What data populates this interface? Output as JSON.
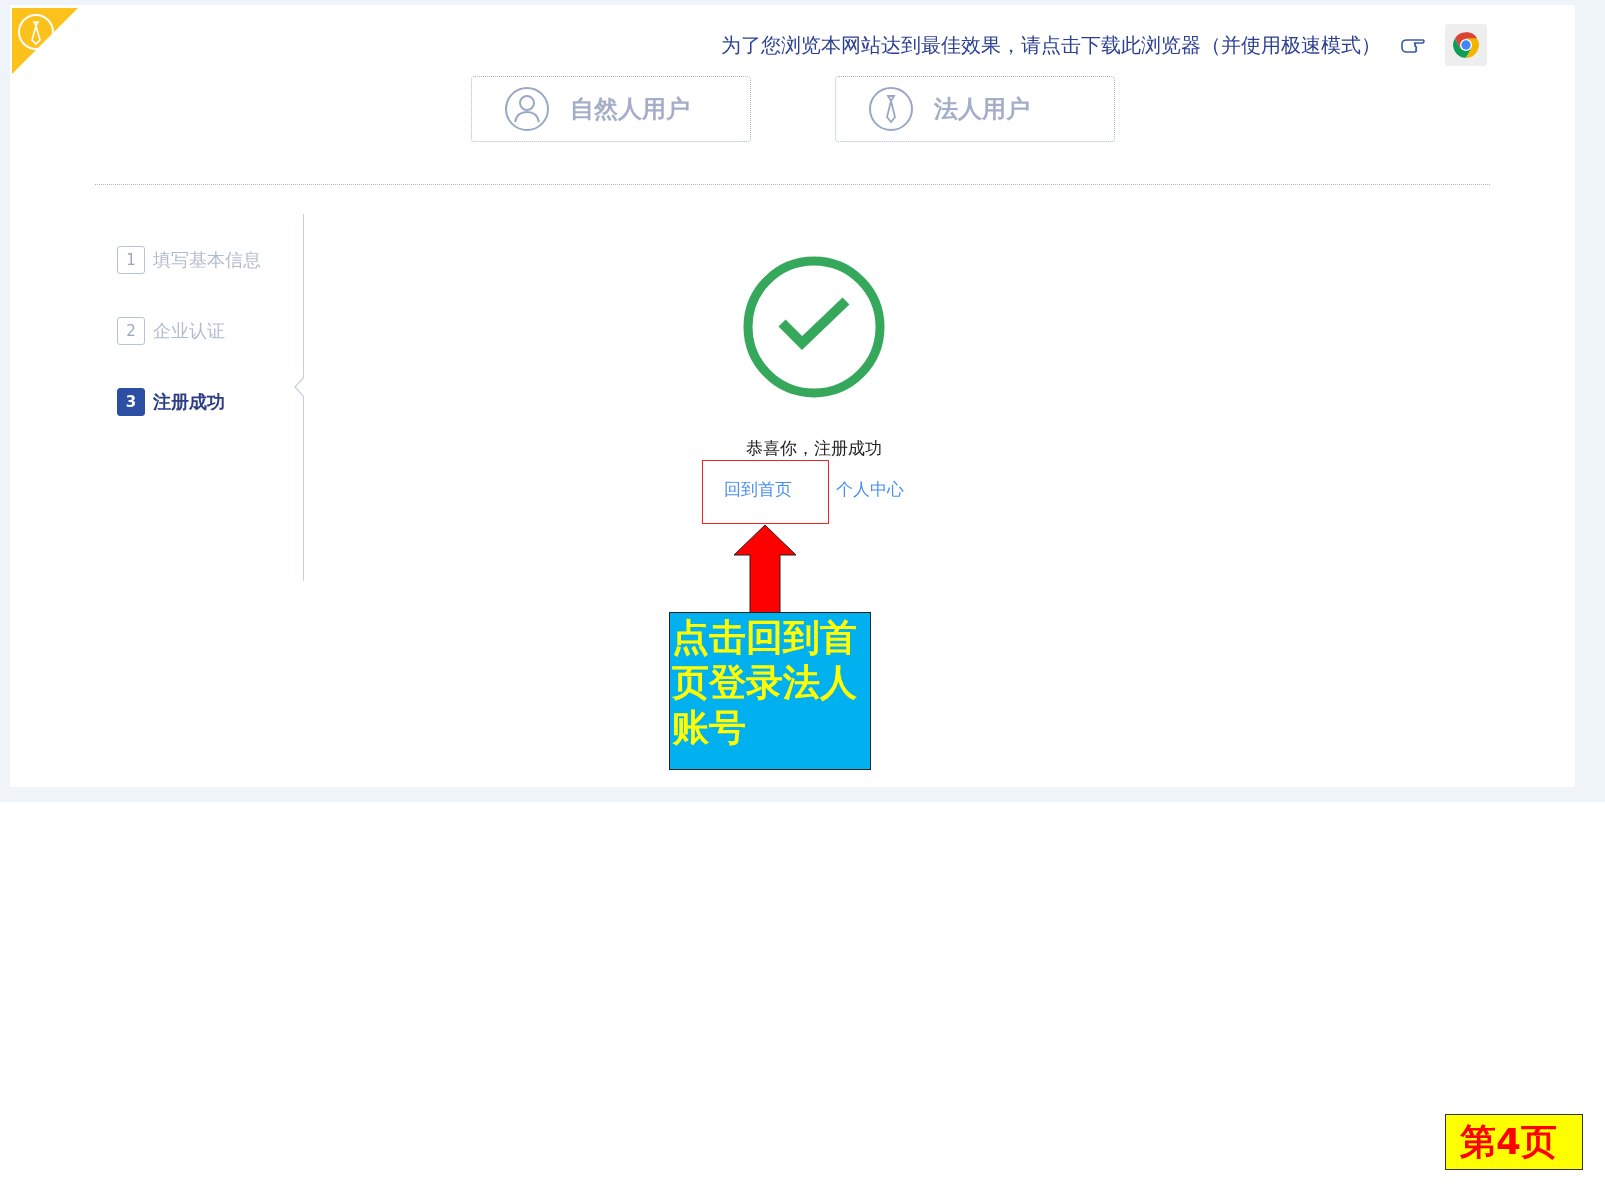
{
  "notice": "为了您浏览本网站达到最佳效果，请点击下载此浏览器（并使用极速模式）",
  "tabs": [
    {
      "label": "自然人用户",
      "kind": "person"
    },
    {
      "label": "法人用户",
      "kind": "tie"
    }
  ],
  "steps": [
    {
      "number": "1",
      "label": "填写基本信息",
      "selected": false
    },
    {
      "number": "2",
      "label": "企业认证",
      "selected": false
    },
    {
      "number": "3",
      "label": "注册成功",
      "selected": true
    }
  ],
  "success": {
    "message": "恭喜你，注册成功",
    "links": [
      "回到首页",
      "个人中心"
    ]
  },
  "annotation": {
    "callout": "点击回到首页登录法人账号"
  },
  "page_label": "第4页"
}
